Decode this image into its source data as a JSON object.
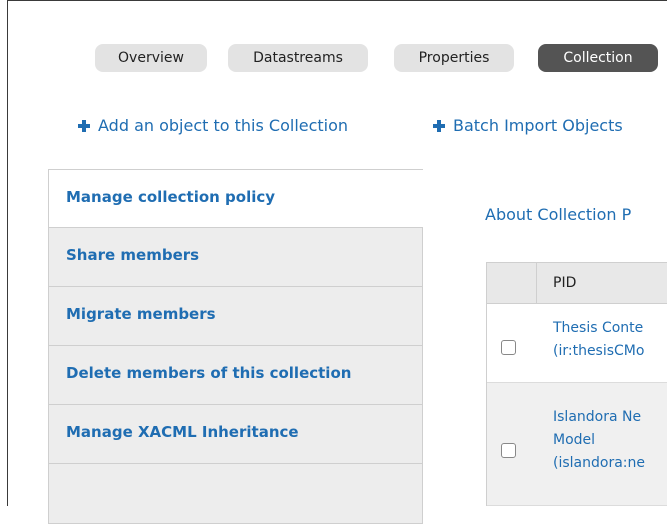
{
  "tabs": [
    {
      "label": "Overview",
      "active": false
    },
    {
      "label": "Datastreams",
      "active": false
    },
    {
      "label": "Properties",
      "active": false
    },
    {
      "label": "Collection",
      "active": true
    }
  ],
  "actions": [
    {
      "label": "Add an object to this Collection"
    },
    {
      "label": "Batch Import Objects"
    }
  ],
  "vnav": [
    {
      "label": "Manage collection policy",
      "selected": true
    },
    {
      "label": "Share members"
    },
    {
      "label": "Migrate members"
    },
    {
      "label": "Delete members of this collection"
    },
    {
      "label": "Manage XACML Inheritance"
    },
    {
      "label": ""
    }
  ],
  "about": "About Collection P",
  "table": {
    "columns": [
      "PID"
    ],
    "rows": [
      {
        "lines": [
          "Thesis Conte",
          "(ir:thesisCMo"
        ]
      },
      {
        "lines": [
          "Islandora Ne",
          "Model",
          "(islandora:ne"
        ]
      }
    ]
  },
  "colors": {
    "link": "#1f6db2",
    "active_tab": "#545454",
    "tab": "#e3e3e3"
  },
  "icons": {
    "action": "plus-icon",
    "checkbox": "checkbox-icon"
  }
}
